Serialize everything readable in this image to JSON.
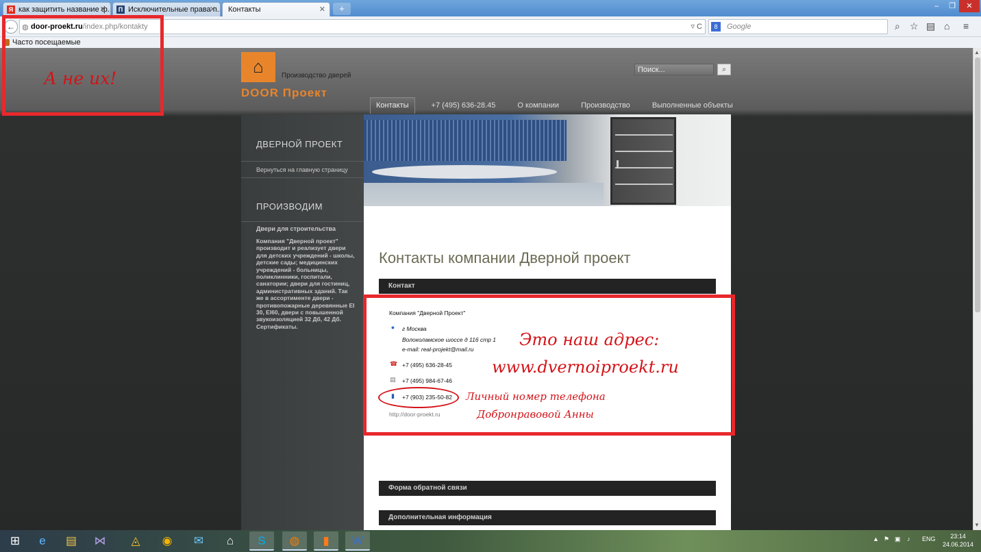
{
  "browser": {
    "tabs": [
      {
        "title": "как защитить название ф...",
        "favicon": "Я",
        "favicon_color": "#e02b20",
        "active": false
      },
      {
        "title": "Исключительные права п...",
        "favicon": "П",
        "favicon_color": "#24426e",
        "active": false
      },
      {
        "title": "Контакты",
        "favicon": "",
        "favicon_color": "",
        "active": true
      }
    ],
    "url_host": "door-proekt.ru",
    "url_path": "/index.php/kontakty",
    "search_placeholder": "Google",
    "bookmark_label": "Часто посещаемые"
  },
  "site": {
    "tagline": "Производство дверей",
    "brand": "DOOR  Проект",
    "brand_color": "#e8852b",
    "search_placeholder": "Поиск...",
    "menu": [
      {
        "label": "Контакты",
        "active": true
      },
      {
        "label": "+7 (495) 636-28.45",
        "active": false
      },
      {
        "label": "О компании",
        "active": false
      },
      {
        "label": "Производство",
        "active": false
      },
      {
        "label": "Выполненные объекты",
        "active": false
      }
    ]
  },
  "sidebar": {
    "heading1": "ДВЕРНОЙ ПРОЕКТ",
    "link1": "Вернуться на главную страницу",
    "heading2": "ПРОИЗВОДИМ",
    "link2": "Двери для  строительства",
    "text": "Компания \"Дверной проект\" производит и реализует двери для детских учреждений - школы, детские сады; медицинских учреждений - больницы, поликлинники, госпитали, санатории; двери для гостиниц, административных зданий. Так же в ассортименте двери - противопожарные деревянные EI 30, EI60, двери с повышенной звукоизоляцией 32 Дб, 42 Дб. Сертификаты."
  },
  "main": {
    "title": "Контакты компании Дверной проект",
    "panel_contact": "Контакт",
    "company": "Компания \"Дверной Проект\"",
    "city": "г Москва",
    "address": "Волоколамское шоссе д 116 стр 1",
    "email": "e-mail: real-projekt@mail.ru",
    "phone1": "+7 (495) 636-28-45",
    "phone2": "+7 (495) 984-67-46",
    "phone3": "+7 (903) 235-50-82",
    "website": "http://door-proekt.ru",
    "panel_form": "Форма обратной связи",
    "panel_extra": "Дополнительная информация"
  },
  "annotations": {
    "not_theirs": "А не их!",
    "our_address_1": "Это наш адрес:",
    "our_address_2": "www.dvernoiproekt.ru",
    "personal_phone_1": "Личный номер телефона",
    "personal_phone_2": "Добронравовой Анны",
    "color": "#e8282c"
  },
  "taskbar": {
    "lang": "ENG",
    "time": "23:14",
    "date": "24.06.2014"
  }
}
